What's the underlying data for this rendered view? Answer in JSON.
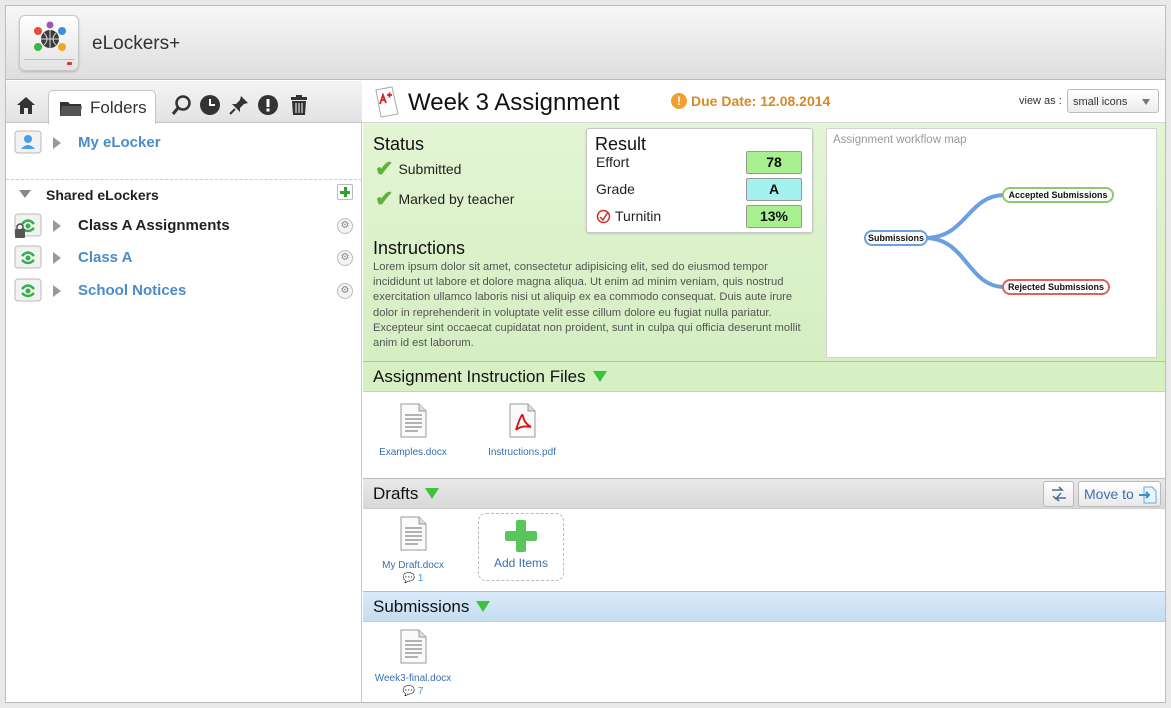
{
  "app": {
    "title": "eLockers+"
  },
  "toolbar": {
    "folders_tab": "Folders"
  },
  "tree": {
    "my_elocker": "My eLocker",
    "shared_header": "Shared eLockers",
    "shared_items": [
      {
        "label": "Class A Assignments"
      },
      {
        "label": "Class A"
      },
      {
        "label": "School Notices"
      }
    ]
  },
  "assignment": {
    "title": "Week 3 Assignment",
    "due_date": "Due Date: 12.08.2014",
    "view_as_label": "view as :",
    "view_as_value": "small icons"
  },
  "status": {
    "heading": "Status",
    "items": [
      "Submitted",
      "Marked by teacher"
    ]
  },
  "result": {
    "heading": "Result",
    "rows": [
      {
        "label": "Effort",
        "value": "78"
      },
      {
        "label": "Grade",
        "value": "A"
      },
      {
        "label": "Turnitin",
        "value": "13%"
      }
    ]
  },
  "instructions": {
    "heading": "Instructions",
    "body": "Lorem ipsum dolor sit amet, consectetur adipisicing elit, sed do eiusmod tempor incididunt ut labore et dolore magna aliqua. Ut enim ad minim veniam, quis nostrud exercitation ullamco laboris nisi ut aliquip ex ea commodo consequat. Duis aute irure dolor in reprehenderit in voluptate velit esse cillum dolore eu fugiat nulla pariatur. Excepteur sint occaecat cupidatat non proident, sunt in culpa qui officia deserunt mollit anim id est laborum."
  },
  "workflow_map": {
    "title": "Assignment workflow map",
    "root": "Submissions",
    "accepted": "Accepted Submissions",
    "rejected": "Rejected Submissions"
  },
  "sections": {
    "instruction_files": {
      "title": "Assignment Instruction Files",
      "files": [
        {
          "name": "Examples.docx"
        },
        {
          "name": "Instructions.pdf"
        }
      ]
    },
    "drafts": {
      "title": "Drafts",
      "move_to": "Move to",
      "files": [
        {
          "name": "My Draft.docx",
          "comments": "1"
        }
      ],
      "add_items": "Add Items"
    },
    "submissions": {
      "title": "Submissions",
      "files": [
        {
          "name": "Week3-final.docx",
          "comments": "7"
        }
      ]
    }
  },
  "colors": {
    "accent_blue": "#4a8cc9",
    "due_orange": "#d48a26",
    "effort_green": "#a8ef8f",
    "grade_cyan": "#a3f2ef",
    "turnitin_green": "#a8ef8f",
    "instruction_files_header": "#d7f0c3",
    "drafts_header": "#dddddd",
    "submissions_header": "#cfe3f5"
  },
  "icons": {
    "toolbar": [
      "home-icon",
      "folder-icon",
      "search-icon",
      "clock-icon",
      "pin-icon",
      "alert-icon",
      "trash-icon"
    ]
  }
}
